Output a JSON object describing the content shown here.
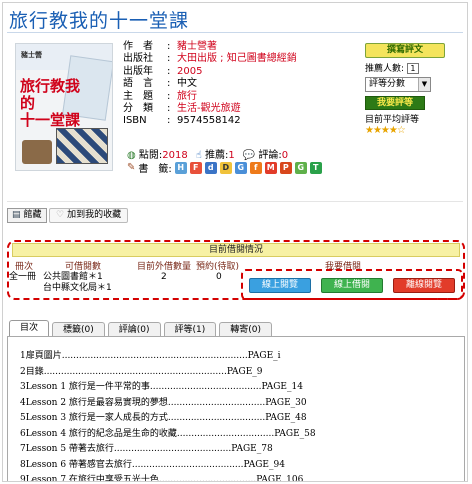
{
  "book": {
    "title": "旅行教我的十一堂課",
    "cover": {
      "publisher_mark": "豬士營",
      "title_lines": [
        "旅行教我的",
        "十一堂課"
      ]
    },
    "info": [
      {
        "label": "作　者",
        "value": "豬士營著",
        "red": true
      },
      {
        "label": "出版社",
        "value": "大田出版 ; 知己圖書總經銷",
        "red": true
      },
      {
        "label": "出版年",
        "value": "2005",
        "red": true
      },
      {
        "label": "語　言",
        "value": "中文",
        "red": false
      },
      {
        "label": "主　題",
        "value": "旅行",
        "red": true
      },
      {
        "label": "分　類",
        "value": "生活-觀光旅遊",
        "red": true
      },
      {
        "label": "ISBN",
        "value": "9574558142",
        "red": false
      }
    ]
  },
  "side": {
    "add_review_button": "撰寫評文",
    "rating_count_label": "推薦人數:",
    "rating_count_value": "1",
    "rating_select": "評等分數",
    "rate_button": "我要評等",
    "avg_label": "目前平均評等",
    "avg_stars": "★★★★☆",
    "colors": {
      "accent_red": "#d0021b",
      "title_blue": "#1a5fb4"
    }
  },
  "stats": {
    "clicks_label": "點閱:",
    "clicks_value": "2018",
    "recommend_label": "推薦:",
    "recommend_value": "1",
    "comments_label": "評論:",
    "comments_value": "0",
    "share_label": "書　籤:"
  },
  "actions": {
    "library_button": "館藏",
    "favorite_button": "加到我的收藏"
  },
  "holdings": {
    "heading": "目前借閱情況",
    "columns": [
      "冊次",
      "可借閱數",
      "目前外借數量",
      "預約(待取)",
      "我要借閱"
    ],
    "row": {
      "volume": "全一冊",
      "locations": [
        "公共圖書館＊1",
        "台中縣文化局＊1"
      ],
      "on_loan": "2",
      "reserved": "0"
    },
    "buttons": [
      "線上閱覽",
      "線上借閱",
      "離線閱覽"
    ]
  },
  "tabs": [
    "目次",
    "標籤(0)",
    "評論(0)",
    "評等(1)",
    "轉寄(0)"
  ],
  "toc": [
    "1扉頁圖片.................................................................PAGE_i",
    "2目錄................................................................PAGE_9",
    "3Lesson 1 旅行是一件平常的事.......................................PAGE_14",
    "4Lesson 2 旅行是最容易實現的夢想..................................PAGE_30",
    "5Lesson 3 旅行是一家人成長的方式..................................PAGE_48",
    "6Lesson 4 旅行的紀念品是生命的收藏..................................PAGE_58",
    "7Lesson 5 帶著去旅行.........................................PAGE_78",
    "8Lesson 6 帶著感官去旅行.......................................PAGE_94",
    "9Lesson 7 在旅行中享受五光十色..................................PAGE_106"
  ]
}
